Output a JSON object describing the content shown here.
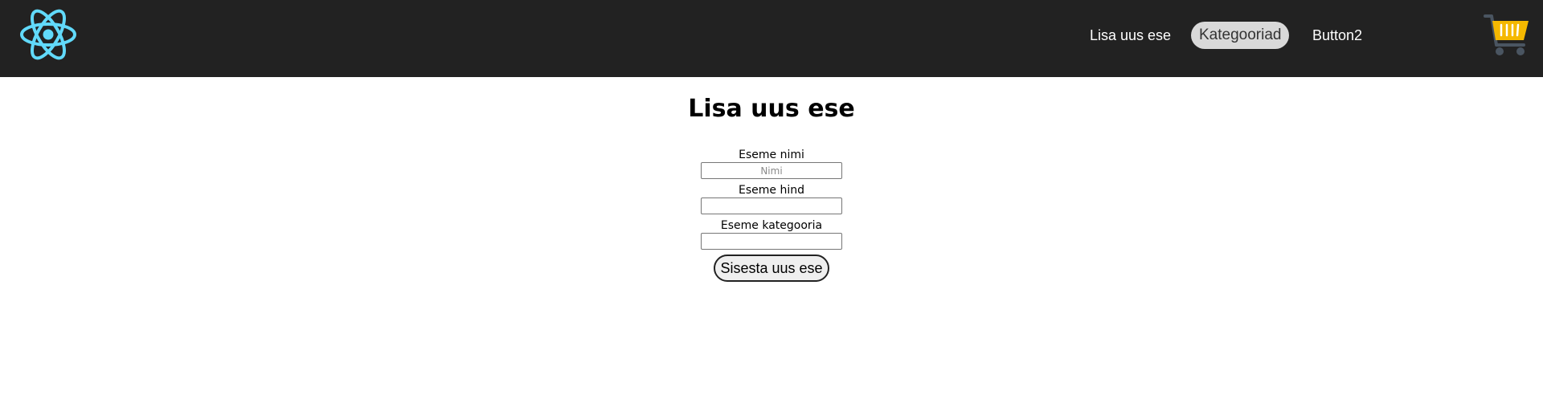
{
  "header": {
    "logo_icon": "react-atom-icon",
    "nav": [
      {
        "label": "Lisa uus ese",
        "active": false
      },
      {
        "label": "Kategooriad",
        "active": true
      },
      {
        "label": "Button2",
        "active": false
      }
    ],
    "cart_icon": "shopping-cart-icon"
  },
  "main": {
    "title": "Lisa uus ese",
    "fields": [
      {
        "label": "Eseme nimi",
        "placeholder": "Nimi",
        "value": ""
      },
      {
        "label": "Eseme hind",
        "placeholder": "",
        "value": ""
      },
      {
        "label": "Eseme kategooria",
        "placeholder": "",
        "value": ""
      }
    ],
    "submit_label": "Sisesta uus ese"
  },
  "colors": {
    "navbar_bg": "#222222",
    "logo": "#61dafb",
    "active_pill_bg": "#d9d9d9",
    "cart_basket": "#f5b800",
    "cart_wheels": "#4a5561"
  }
}
